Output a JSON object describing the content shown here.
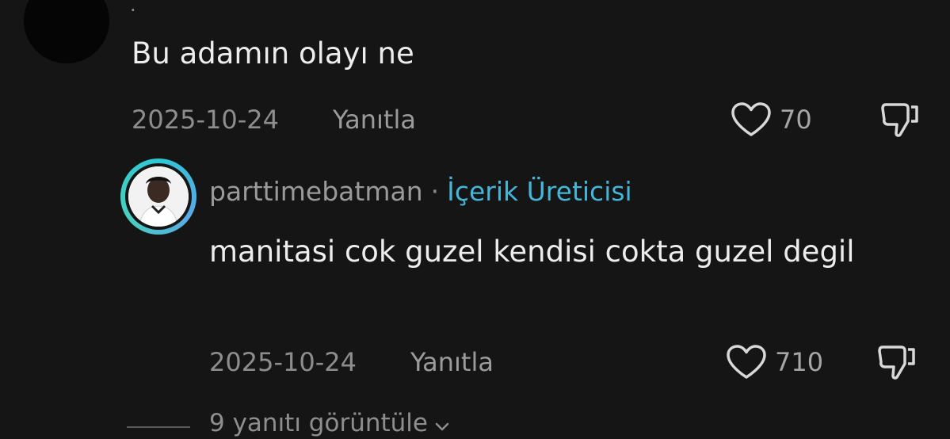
{
  "comment": {
    "username": ".",
    "text": "Bu adamın olayı ne",
    "date": "2025-10-24",
    "reply_label": "Yanıtla",
    "likes": "70"
  },
  "reply": {
    "username": "parttimebatman",
    "separator": "·",
    "badge": "İçerik Üreticisi",
    "text": "manitasi cok guzel kendisi cokta guzel degil",
    "date": "2025-10-24",
    "reply_label": "Yanıtla",
    "likes": "710"
  },
  "view_replies": {
    "label": "9 yanıtı görüntüle"
  },
  "colors": {
    "background": "#151515",
    "creator_badge": "#43b6d9",
    "avatar_ring": "#2ec7d6"
  },
  "icons": [
    "heart-icon",
    "dislike-icon",
    "chevron-down-icon"
  ]
}
